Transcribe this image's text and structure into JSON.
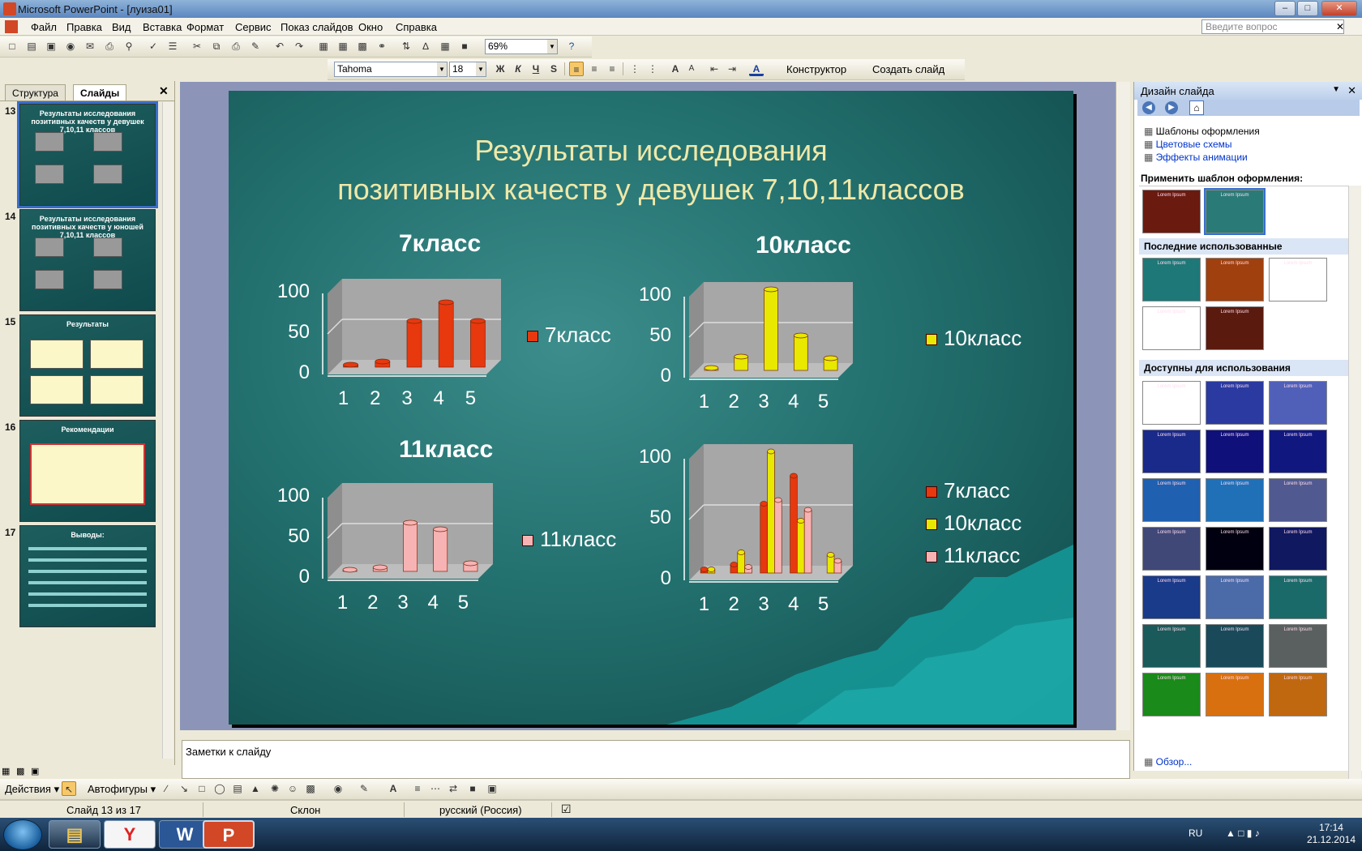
{
  "window": {
    "title": "Microsoft PowerPoint - [луиза01]"
  },
  "menu": [
    "Файл",
    "Правка",
    "Вид",
    "Вставка",
    "Формат",
    "Сервис",
    "Показ слайдов",
    "Окно",
    "Справка"
  ],
  "ask_placeholder": "Введите вопрос",
  "toolbar": {
    "zoom": "69%",
    "font": "Tahoma",
    "size": "18",
    "bold": "Ж",
    "italic": "К",
    "underline": "Ч",
    "shadow": "S",
    "designer": "Конструктор",
    "new_slide": "Создать слайд"
  },
  "left_panel": {
    "tabs": [
      "Структура",
      "Слайды"
    ],
    "thumbs": [
      {
        "num": "13",
        "title": "Результаты исследования позитивных качеств у девушек 7,10,11 классов"
      },
      {
        "num": "14",
        "title": "Результаты исследования позитивных качеств у юношей 7,10,11 классов"
      },
      {
        "num": "15",
        "title": "Результаты"
      },
      {
        "num": "16",
        "title": "Рекомендации"
      },
      {
        "num": "17",
        "title": "Выводы:"
      }
    ]
  },
  "slide": {
    "title_line1": "Результаты исследования",
    "title_line2": "позитивных качеств у девушек 7,10,11классов"
  },
  "colors": {
    "red": "#e8380e",
    "yellow": "#e8e800",
    "pink": "#f7b3b3",
    "slide_bg": "#23716f",
    "title": "#f0e8a8"
  },
  "chart_data": [
    {
      "type": "bar",
      "title": "7класс",
      "categories": [
        "1",
        "2",
        "3",
        "4",
        "5"
      ],
      "ylim": [
        0,
        100
      ],
      "yticks": [
        "0",
        "50",
        "100"
      ],
      "series": [
        {
          "name": "7класс",
          "values": [
            3,
            7,
            57,
            80,
            57
          ]
        }
      ]
    },
    {
      "type": "bar",
      "title": "10класс",
      "categories": [
        "1",
        "2",
        "3",
        "4",
        "5"
      ],
      "ylim": [
        0,
        100
      ],
      "yticks": [
        "0",
        "50",
        "100"
      ],
      "series": [
        {
          "name": "10класс",
          "values": [
            3,
            17,
            100,
            43,
            15
          ]
        }
      ]
    },
    {
      "type": "bar",
      "title": "11класс",
      "categories": [
        "1",
        "2",
        "3",
        "4",
        "5"
      ],
      "ylim": [
        0,
        100
      ],
      "yticks": [
        "0",
        "50",
        "100"
      ],
      "series": [
        {
          "name": "11класс",
          "values": [
            2,
            5,
            60,
            52,
            10
          ]
        }
      ]
    },
    {
      "type": "bar",
      "title": "",
      "categories": [
        "1",
        "2",
        "3",
        "4",
        "5"
      ],
      "ylim": [
        0,
        100
      ],
      "yticks": [
        "0",
        "50",
        "100"
      ],
      "series": [
        {
          "name": "7класс",
          "values": [
            3,
            7,
            57,
            80,
            0
          ]
        },
        {
          "name": "10класс",
          "values": [
            3,
            17,
            100,
            43,
            15
          ]
        },
        {
          "name": "11класс",
          "values": [
            0,
            5,
            60,
            52,
            10
          ]
        }
      ]
    }
  ],
  "task_pane": {
    "title": "Дизайн слайда",
    "links": [
      "Шаблоны оформления",
      "Цветовые схемы",
      "Эффекты анимации"
    ],
    "apply_label": "Применить шаблон оформления:",
    "recent_label": "Последние использованные",
    "available_label": "Доступны для использования",
    "browse": "Обзор...",
    "template_text": "Lorem Ipsum"
  },
  "notes_placeholder": "Заметки к слайду",
  "drawing": {
    "actions": "Действия",
    "autoshapes": "Автофигуры"
  },
  "status": {
    "slide": "Слайд 13 из 17",
    "design": "Склон",
    "lang": "русский (Россия)"
  },
  "taskbar": {
    "lang": "RU",
    "time": "17:14",
    "date": "21.12.2014"
  }
}
